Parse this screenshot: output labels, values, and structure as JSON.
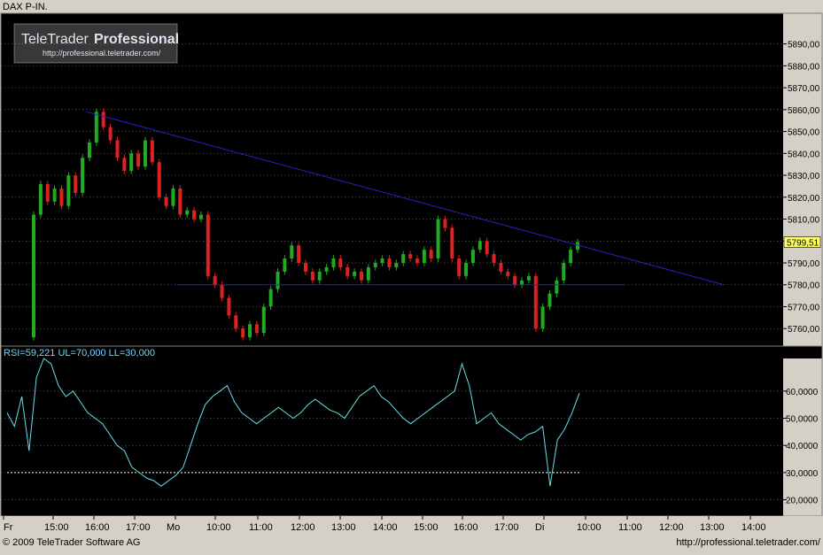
{
  "header": {
    "instrument": "DAX P-IN."
  },
  "watermark": {
    "brand_light": "TeleTrader",
    "brand_bold": "Professional",
    "url": "http://professional.teletrader.com/"
  },
  "footer": {
    "copyright": "© 2009 TeleTrader Software AG",
    "url": "http://professional.teletrader.com/"
  },
  "colors": {
    "background": "#000000",
    "frame": "#d4d0c8",
    "up": "#22aa22",
    "down": "#dd2222",
    "trendline": "#2222cc",
    "rsi_line": "#66e0e8",
    "grid": "#9a9a9a",
    "price_label_bg": "#ffff66"
  },
  "chart_data": [
    {
      "type": "candlestick",
      "title": "DAX P-IN.",
      "ylim": [
        5752,
        5904
      ],
      "y_ticks": [
        "5760,00",
        "5770,00",
        "5780,00",
        "5790,00",
        "5800,00",
        "5810,00",
        "5820,00",
        "5830,00",
        "5840,00",
        "5850,00",
        "5860,00",
        "5870,00",
        "5880,00",
        "5890,00"
      ],
      "last_price_label": "5799,51",
      "trendlines": [
        {
          "type": "resistance",
          "from": [
            "Fr 15:45",
            5859
          ],
          "to": [
            "Di 13:00",
            5780
          ]
        },
        {
          "type": "support",
          "from": [
            "Mo 09:00",
            5780
          ],
          "to": [
            "Di 11:45",
            5780
          ]
        }
      ],
      "grid": true,
      "candle_closes": [
        5812,
        5826,
        5818,
        5824,
        5816,
        5830,
        5822,
        5838,
        5845,
        5859,
        5852,
        5846,
        5838,
        5832,
        5840,
        5834,
        5846,
        5836,
        5820,
        5816,
        5824,
        5812,
        5814,
        5810,
        5812,
        5784,
        5780,
        5774,
        5766,
        5760,
        5756,
        5762,
        5758,
        5770,
        5778,
        5786,
        5792,
        5798,
        5790,
        5786,
        5782,
        5786,
        5788,
        5792,
        5788,
        5784,
        5786,
        5782,
        5788,
        5790,
        5792,
        5788,
        5790,
        5794,
        5792,
        5790,
        5796,
        5792,
        5810,
        5806,
        5792,
        5784,
        5790,
        5796,
        5800,
        5794,
        5790,
        5786,
        5784,
        5780,
        5782,
        5784,
        5760,
        5770,
        5776,
        5782,
        5790,
        5796,
        5799.51
      ],
      "candle_opens": [
        5756,
        5812,
        5826,
        5818,
        5824,
        5816,
        5830,
        5822,
        5838,
        5845,
        5859,
        5852,
        5846,
        5838,
        5832,
        5840,
        5834,
        5846,
        5836,
        5820,
        5816,
        5824,
        5812,
        5814,
        5810,
        5812,
        5784,
        5780,
        5774,
        5766,
        5760,
        5756,
        5762,
        5758,
        5770,
        5778,
        5786,
        5792,
        5798,
        5790,
        5786,
        5782,
        5786,
        5788,
        5792,
        5788,
        5784,
        5786,
        5782,
        5788,
        5790,
        5792,
        5788,
        5790,
        5794,
        5792,
        5790,
        5796,
        5792,
        5810,
        5806,
        5792,
        5784,
        5790,
        5796,
        5800,
        5794,
        5790,
        5786,
        5784,
        5780,
        5782,
        5784,
        5760,
        5770,
        5776,
        5782,
        5790,
        5796
      ]
    },
    {
      "type": "line",
      "title": "RSI=59,221  UL=70,000  LL=30,000",
      "ylim": [
        14,
        72
      ],
      "y_ticks": [
        "20,0000",
        "30,0000",
        "40,0000",
        "50,0000",
        "60,0000"
      ],
      "upper_limit": 70,
      "lower_limit": 30,
      "series": [
        {
          "name": "RSI",
          "values": [
            52,
            47,
            58,
            38,
            65,
            72,
            70,
            62,
            58,
            60,
            56,
            52,
            50,
            48,
            44,
            40,
            38,
            32,
            30,
            28,
            27,
            25,
            27,
            29,
            32,
            40,
            48,
            55,
            58,
            60,
            62,
            56,
            52,
            50,
            48,
            50,
            52,
            54,
            52,
            50,
            52,
            55,
            57,
            55,
            53,
            52,
            50,
            54,
            58,
            60,
            62,
            58,
            56,
            53,
            50,
            48,
            50,
            52,
            54,
            56,
            58,
            60,
            70,
            62,
            48,
            50,
            52,
            48,
            46,
            44,
            42,
            44,
            45,
            47,
            25,
            42,
            46,
            52,
            59.221
          ]
        }
      ],
      "x_tick_labels": [
        "Fr",
        "15:00",
        "16:00",
        "17:00",
        "Mo",
        "10:00",
        "11:00",
        "12:00",
        "13:00",
        "14:00",
        "15:00",
        "16:00",
        "17:00",
        "Di",
        "10:00",
        "11:00",
        "12:00",
        "13:00",
        "14:00"
      ]
    }
  ]
}
